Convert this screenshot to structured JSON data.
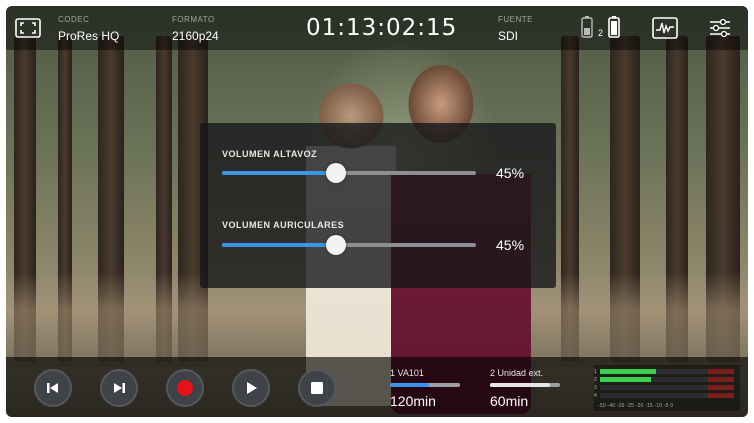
{
  "topbar": {
    "codec_label": "CODEC",
    "codec_value": "ProRes HQ",
    "format_label": "FORMATO",
    "format_value": "2160p24",
    "timecode": "01:13:02:15",
    "source_label": "FUENTE",
    "source_value": "SDI",
    "battery_slot_2": "2"
  },
  "audio": {
    "speaker_label": "VOLUMEN ALTAVOZ",
    "speaker_percent_text": "45%",
    "speaker_level": 0.45,
    "headphone_label": "VOLUMEN AURICULARES",
    "headphone_percent_text": "45%",
    "headphone_level": 0.45
  },
  "media": [
    {
      "name": "1  VA101",
      "time": "120min",
      "fill": 0.55,
      "color": "#3b95ec"
    },
    {
      "name": "2  Unidad ext.",
      "time": "60min",
      "fill": 0.85,
      "color": "#e6e6e6"
    }
  ],
  "meters": {
    "scale": "-50 -40    -26 -25 -20    -15 -10   -5   0",
    "channels": [
      {
        "index": "1",
        "level": 0.42
      },
      {
        "index": "2",
        "level": 0.38
      },
      {
        "index": "3",
        "level": 0.0
      },
      {
        "index": "4",
        "level": 0.0
      }
    ]
  },
  "icons": {
    "fullscreen": "fullscreen-frame-icon",
    "battery": "battery-icon",
    "scope": "waveform-scope-icon",
    "settings": "settings-sliders-icon",
    "prev": "skip-previous-icon",
    "next": "skip-next-icon",
    "record": "record-icon",
    "play": "play-icon",
    "stop": "stop-icon"
  },
  "colors": {
    "accent": "#3b95ec",
    "record": "#e5121b",
    "meter_green": "#3ccf4f"
  }
}
